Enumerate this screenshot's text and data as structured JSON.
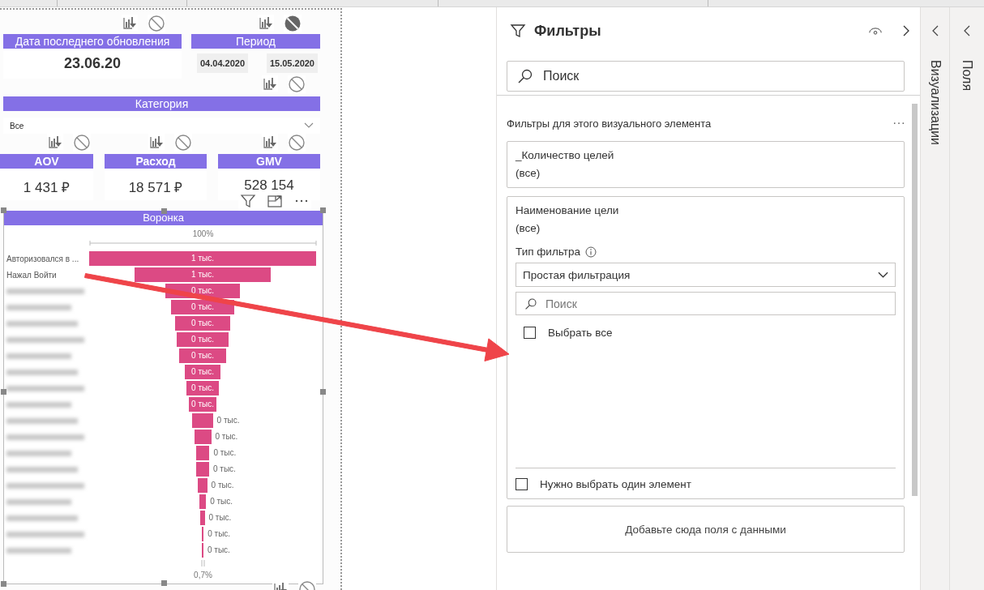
{
  "report": {
    "last_update": {
      "title": "Дата последнего обновления",
      "value": "23.06.20",
      "none_selected": false
    },
    "period": {
      "title": "Период",
      "start": "04.04.2020",
      "end": "15.05.2020",
      "none_selected": true
    },
    "category": {
      "title": "Категория",
      "value": "Все",
      "none_selected": false
    },
    "kpis": [
      {
        "title": "AOV",
        "value": "1 431 ₽",
        "none_selected": false
      },
      {
        "title": "Расход",
        "value": "18 571 ₽",
        "none_selected": false
      },
      {
        "title": "GMV",
        "value": "528 154",
        "none_selected": false
      }
    ],
    "funnel": {
      "none_selected": false,
      "title": "Воронка",
      "top_label": "100%",
      "bottom_label": "0,7%",
      "rows": [
        {
          "label": "Авторизовался в ...",
          "blurred": false,
          "value": "1 тыс."
        },
        {
          "label": "Нажал Войти",
          "blurred": false,
          "value": "1 тыс."
        },
        {
          "blurred": true,
          "value": "0 тыс."
        },
        {
          "blurred": true,
          "value": "0 тыс."
        },
        {
          "blurred": true,
          "value": "0 тыс."
        },
        {
          "blurred": true,
          "value": "0 тыс."
        },
        {
          "blurred": true,
          "value": "0 тыс."
        },
        {
          "blurred": true,
          "value": "0 тыс."
        },
        {
          "blurred": true,
          "value": "0 тыс."
        },
        {
          "blurred": true,
          "value": "0 тыс."
        },
        {
          "blurred": true,
          "value": "0 тыс."
        },
        {
          "blurred": true,
          "value": "0 тыс."
        },
        {
          "blurred": true,
          "value": "0 тыс."
        },
        {
          "blurred": true,
          "value": "0 тыс."
        },
        {
          "blurred": true,
          "value": "0 тыс."
        },
        {
          "blurred": true,
          "value": "0 тыс."
        },
        {
          "blurred": true,
          "value": "0 тыс."
        },
        {
          "blurred": true,
          "value": "0 тыс."
        },
        {
          "blurred": true,
          "value": "0 тыс."
        }
      ]
    }
  },
  "filters_pane": {
    "title": "Фильтры",
    "search_placeholder": "Поиск",
    "section_title": "Фильтры для этого визуального элемента",
    "cards": [
      {
        "kind": "collapsed",
        "title": "_Количество целей",
        "value": "(все)"
      },
      {
        "kind": "expanded",
        "title": "Наименование цели",
        "value": "(все)",
        "filter_type_label": "Тип фильтра",
        "filter_type": "Простая фильтрация",
        "search_placeholder": "Поиск",
        "select_all": {
          "label": "Выбрать все",
          "checked": false
        },
        "single_select": {
          "label": "Нужно выбрать один элемент",
          "checked": false
        }
      }
    ],
    "drop_zone": "Добавьте сюда поля с данными"
  },
  "side_panes": [
    {
      "title": "Визуализации"
    },
    {
      "title": "Поля"
    }
  ]
}
